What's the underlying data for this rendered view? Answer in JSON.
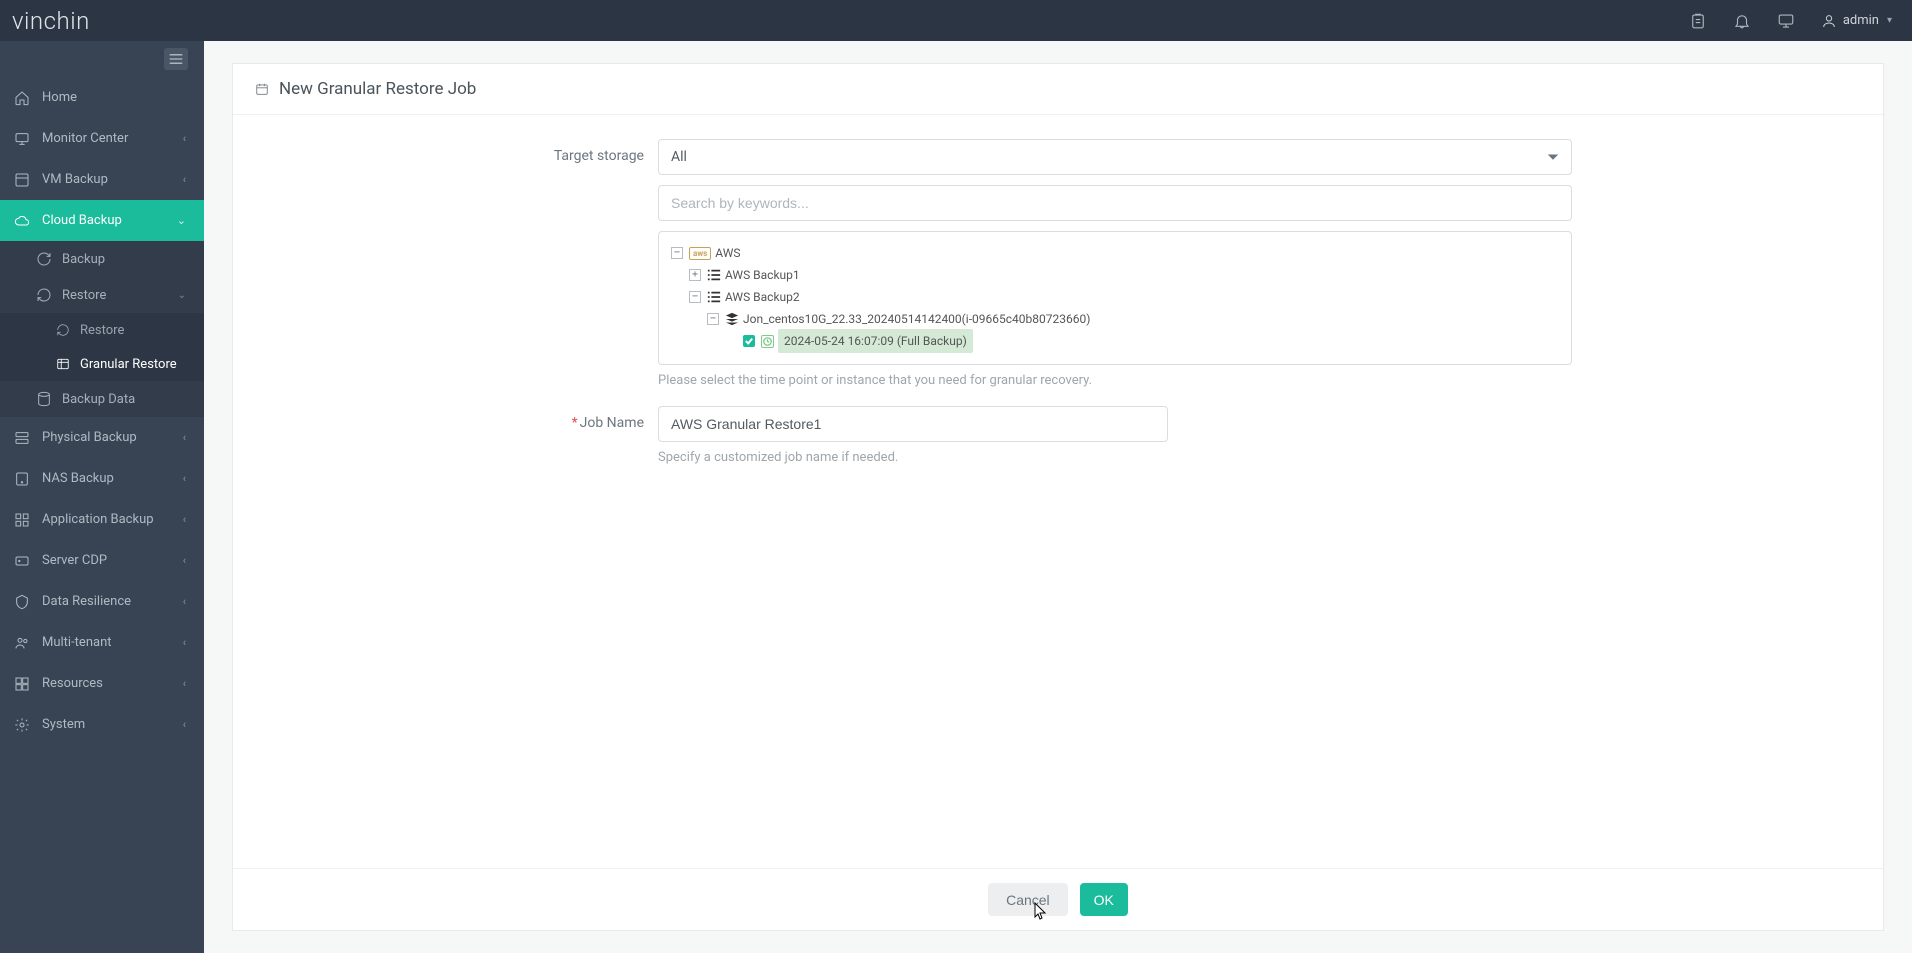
{
  "brand": "vinchin",
  "user": {
    "name": "admin"
  },
  "sidebar": {
    "home": "Home",
    "monitor": "Monitor Center",
    "vm": "VM Backup",
    "cloud": "Cloud Backup",
    "cloud_sub": {
      "backup": "Backup",
      "restore": "Restore",
      "restore_sub": {
        "restore": "Restore",
        "granular": "Granular Restore"
      },
      "backup_data": "Backup Data"
    },
    "physical": "Physical Backup",
    "nas": "NAS Backup",
    "app": "Application Backup",
    "cdp": "Server CDP",
    "resilience": "Data Resilience",
    "multi": "Multi-tenant",
    "resources": "Resources",
    "system": "System"
  },
  "page": {
    "title": "New Granular Restore Job",
    "target_storage_label": "Target storage",
    "storage_selected": "All",
    "search_placeholder": "Search by keywords...",
    "tree": {
      "root": "AWS",
      "backup1": "AWS Backup1",
      "backup2": "AWS Backup2",
      "instance": "Jon_centos10G_22.33_20240514142400(i-09665c40b80723660)",
      "timepoint": "2024-05-24 16:07:09 (Full Backup)"
    },
    "tree_help": "Please select the time point or instance that you need for granular recovery.",
    "job_name_label": "Job Name",
    "job_name_value": "AWS Granular Restore1",
    "job_name_help": "Specify a customized job name if needed.",
    "cancel": "Cancel",
    "ok": "OK"
  }
}
